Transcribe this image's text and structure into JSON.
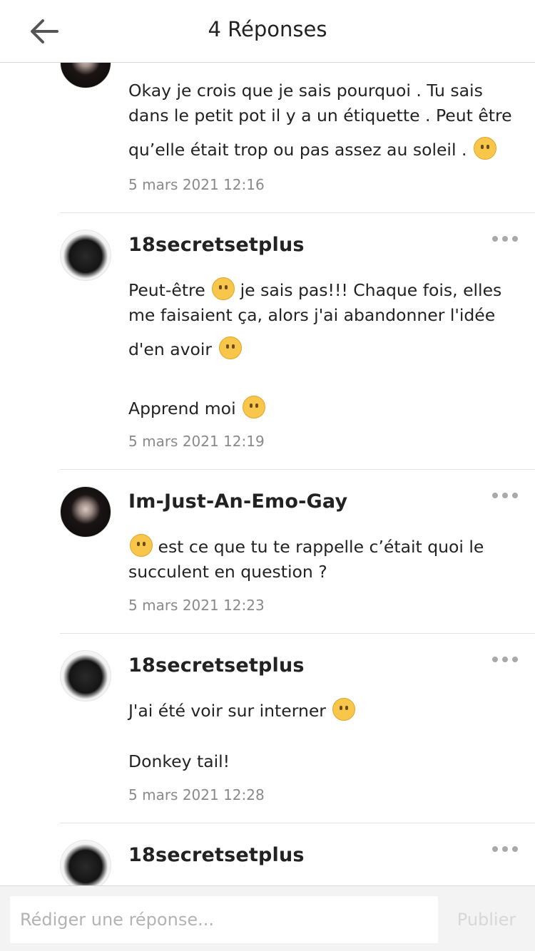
{
  "header": {
    "title": "4 Réponses"
  },
  "comments": [
    {
      "username": "",
      "avatar": "emo",
      "text_lines": [
        "Okay je crois que je sais pourquoi . Tu sais",
        "dans le petit pot il y a un étiquette . Peut être",
        "qu’elle était trop ou pas assez au soleil ."
      ],
      "emoji": "worried-face",
      "timestamp": "5 mars 2021 12:16"
    },
    {
      "username": "18secretsetplus",
      "avatar": "wolf",
      "line1_pre": "Peut-être",
      "line1_post": "je sais pas!!! Chaque fois, elles",
      "line2": "me faisaient ça, alors j'ai abandonner l'idée",
      "line3": "d'en avoir",
      "line4": "Apprend moi",
      "emojis": [
        "crying-face",
        "pensive-face",
        "pleading-face"
      ],
      "timestamp": "5 mars 2021 12:19"
    },
    {
      "username": "Im-Just-An-Emo-Gay",
      "avatar": "emo",
      "line1": "est ce que tu te rappelle c’était quoi le",
      "line2": "succulent en question ?",
      "emoji": "rofl-face",
      "timestamp": "5 mars 2021 12:23"
    },
    {
      "username": "18secretsetplus",
      "avatar": "wolf",
      "line1": "J'ai été voir sur interner",
      "line2": "Donkey tail!",
      "emoji": "grinning-face",
      "timestamp": "5 mars 2021 12:28"
    },
    {
      "username": "18secretsetplus",
      "avatar": "wolf"
    }
  ],
  "composer": {
    "placeholder": "Rédiger une réponse...",
    "publish_label": "Publier"
  }
}
